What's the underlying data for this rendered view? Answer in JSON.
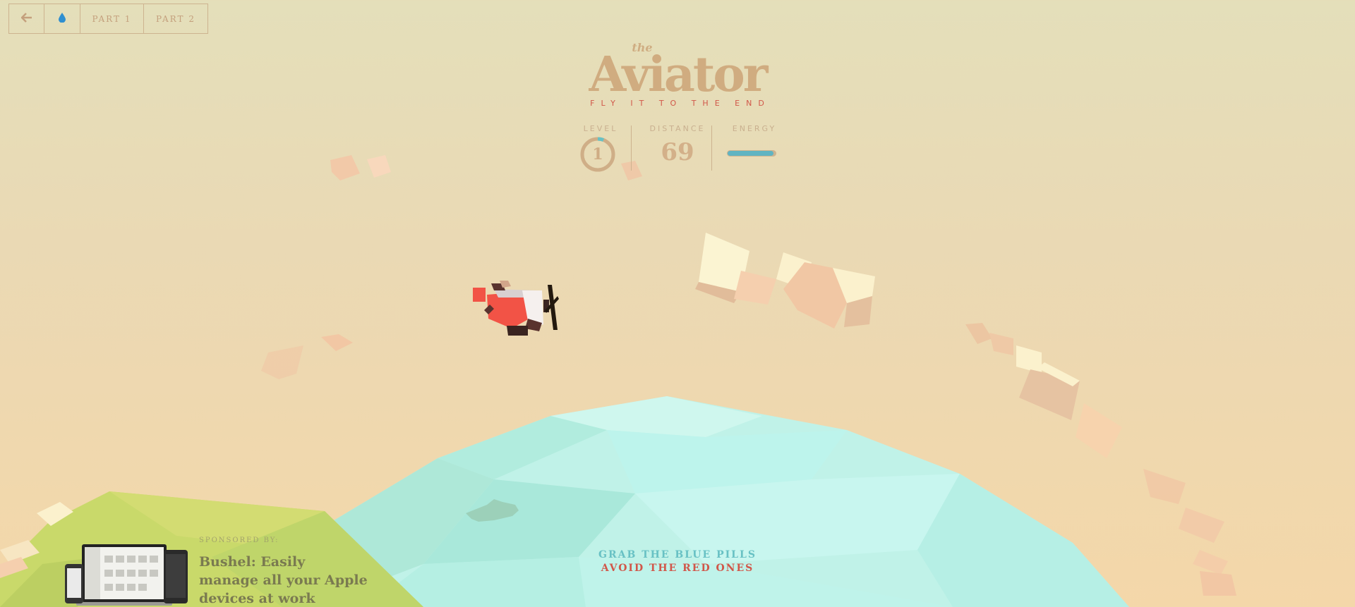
{
  "nav": {
    "back_icon": "arrow-left-icon",
    "drop_icon": "water-drop-icon",
    "part1_label": "PART 1",
    "part2_label": "PART 2"
  },
  "title": {
    "the": "the",
    "main": "Aviator",
    "tagline": "FLY IT TO THE END"
  },
  "score": {
    "level_label": "LEVEL",
    "level_value": "1",
    "level_progress": 0.06,
    "distance_label": "DISTANCE",
    "distance_value": "69",
    "energy_label": "ENERGY",
    "energy_level": 0.95
  },
  "instructions": {
    "line1": "GRAB THE BLUE PILLS",
    "line2": "AVOID THE RED ONES"
  },
  "sponsor": {
    "label": "SPONSORED BY:",
    "text": "Bushel: Easily manage all your Apple devices at work"
  },
  "colors": {
    "sky_top": "#e4dfba",
    "sky_bottom": "#f4d7a9",
    "sea": "#b7f0e6",
    "accent_red": "#d1574a",
    "accent_blue": "#68c1c4",
    "plane_red": "#f25346",
    "cloud": "#f5cfae"
  }
}
